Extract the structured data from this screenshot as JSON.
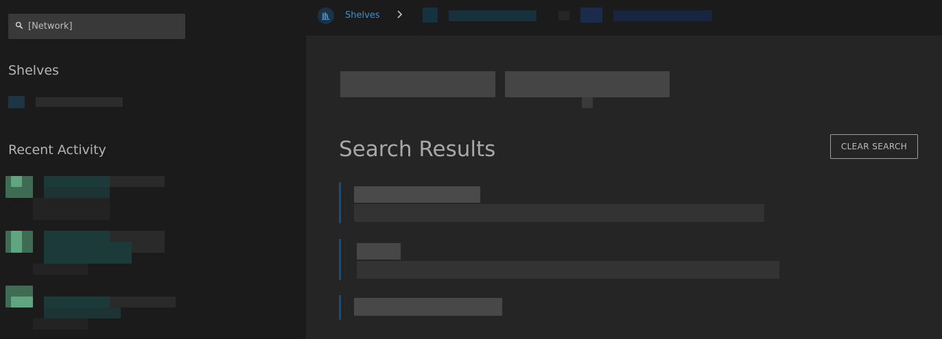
{
  "search": {
    "value": "[Network]"
  },
  "sidebar": {
    "shelves_heading": "Shelves",
    "recent_heading": "Recent Activity"
  },
  "breadcrumb": {
    "shelves_label": "Shelves"
  },
  "main": {
    "results_title": "Search Results",
    "clear_button": "CLEAR SEARCH"
  },
  "colors": {
    "sidebar_bg": "#1b1b1b",
    "main_bg": "#252525",
    "accent_link": "#3e8fc9",
    "result_bar": "#1f4c6e",
    "avatar_green": "#5fa57f"
  },
  "icons": {
    "search": "search-icon",
    "shelves_breadcrumb": "bookshelf-icon",
    "breadcrumb_separator": "chevron-right-icon"
  }
}
